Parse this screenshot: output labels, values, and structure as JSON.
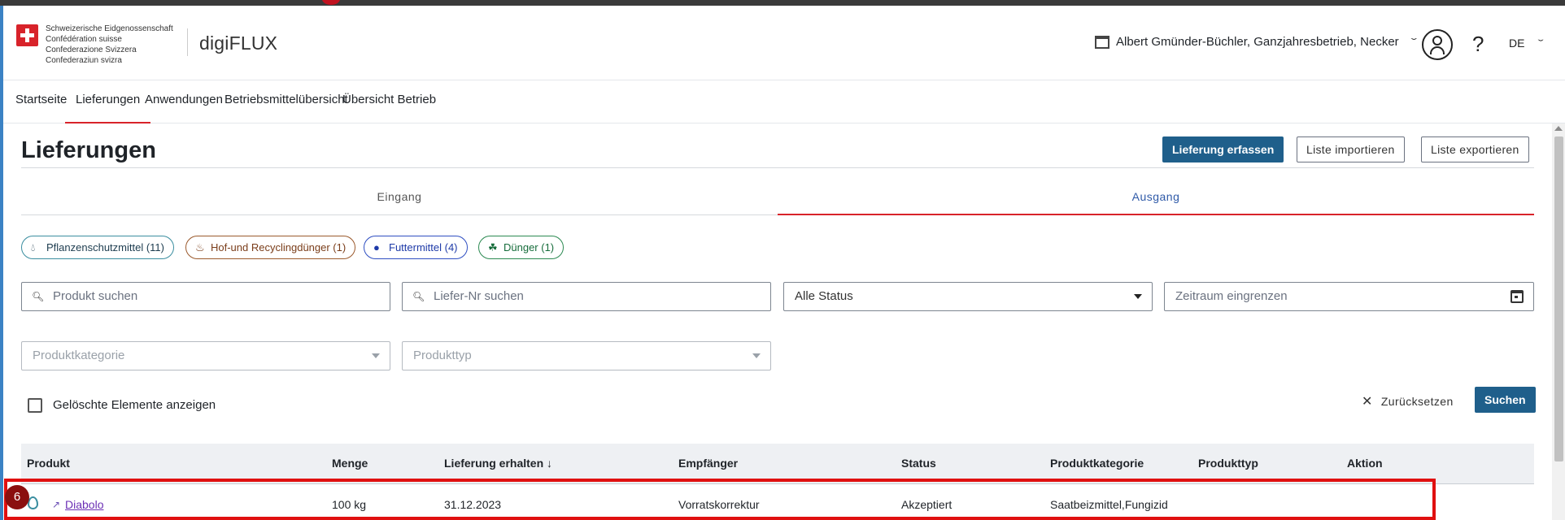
{
  "header": {
    "confederation": [
      "Schweizerische Eidgenossenschaft",
      "Confédération suisse",
      "Confederazione Svizzera",
      "Confederaziun svizra"
    ],
    "app_name": "digiFLUX",
    "business": "Albert Gmünder-Büchler, Ganzjahresbetrieb, Necker",
    "help": "?",
    "language": "DE"
  },
  "nav": {
    "items": [
      "Startseite",
      "Lieferungen",
      "Anwendungen",
      "Betriebsmittelübersicht",
      "Übersicht Betrieb"
    ],
    "active": "Lieferungen"
  },
  "page": {
    "title": "Lieferungen",
    "buttons": {
      "create": "Lieferung erfassen",
      "import": "Liste importieren",
      "export": "Liste exportieren"
    },
    "tabs": [
      "Eingang",
      "Ausgang"
    ],
    "active_tab": "Ausgang"
  },
  "chips": [
    {
      "label": "Pflanzenschutzmittel (11)",
      "icon": "drop-icon"
    },
    {
      "label": "Hof-und Recyclingdünger (1)",
      "icon": "manure-icon"
    },
    {
      "label": "Futtermittel (4)",
      "icon": "paw-icon"
    },
    {
      "label": "Dünger (1)",
      "icon": "sprout-icon"
    }
  ],
  "filters": {
    "product_placeholder": "Produkt suchen",
    "delivery_placeholder": "Liefer-Nr suchen",
    "status_value": "Alle Status",
    "period_placeholder": "Zeitraum eingrenzen",
    "category_placeholder": "Produktkategorie",
    "type_placeholder": "Produkttyp",
    "show_deleted": "Gelöschte Elemente anzeigen",
    "reset": "Zurücksetzen",
    "search": "Suchen"
  },
  "table": {
    "columns": [
      "Produkt",
      "Menge",
      "Lieferung erhalten ↓",
      "Empfänger",
      "Status",
      "Produktkategorie",
      "Produkttyp",
      "Aktion"
    ],
    "rows": [
      {
        "product": "Diabolo",
        "amount": "100 kg",
        "received": "31.12.2023",
        "recipient": "Vorratskorrektur",
        "status": "Akzeptiert",
        "category": "Saatbeizmittel,Fungizid",
        "type": "",
        "action": ""
      }
    ]
  },
  "annotation": {
    "badge": "6",
    "color": "#e01010"
  },
  "colors": {
    "primary": "#1f5f8b",
    "accent_red": "#d8232a",
    "link": "#6b2fb5",
    "active_tab": "#2f5aa8"
  }
}
